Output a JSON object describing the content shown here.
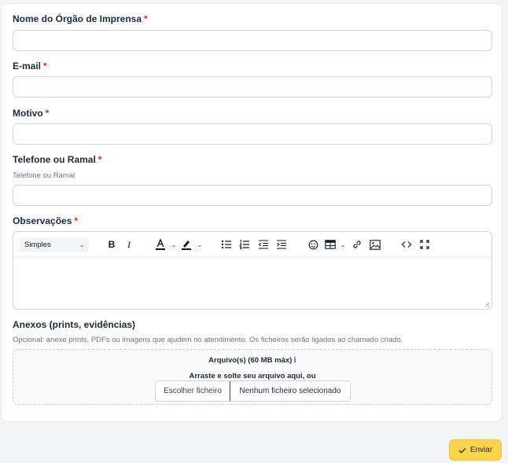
{
  "form": {
    "required_mark": "*",
    "fields": {
      "orgao": {
        "label": "Nome do Órgão de Imprensa",
        "value": ""
      },
      "email": {
        "label": "E-mail",
        "value": ""
      },
      "motivo": {
        "label": "Motivo",
        "value": ""
      },
      "telefone": {
        "label": "Telefone ou Ramal",
        "hint": "Telefone ou Ramal",
        "value": ""
      },
      "observacoes": {
        "label": "Observações"
      }
    },
    "editor": {
      "format_select": "Simples",
      "icons": [
        "bold-icon",
        "italic-icon",
        "text-color-icon",
        "highlight-color-icon",
        "bullet-list-icon",
        "numbered-list-icon",
        "outdent-icon",
        "indent-icon",
        "emoji-icon",
        "table-icon",
        "link-icon",
        "image-icon",
        "code-view-icon",
        "fullscreen-icon"
      ]
    },
    "attachments": {
      "label": "Anexos (prints, evidências)",
      "hint": "Opcional: anexe prints, PDFs ou imagens que ajudem no atendimento. Os ficheiros serão ligados ao chamado criado.",
      "title": "Arquivo(s) (60 MB máx)",
      "info_glyph": "ℹ",
      "drop_text": "Arraste e solte seu arquivo aqui, ou",
      "choose_button": "Escolher ficheiro",
      "no_file": "Nenhum ficheiro selecionado"
    },
    "submit_label": "Enviar"
  },
  "colors": {
    "required": "#dc2626",
    "submit_bg": "#fcd34d"
  }
}
